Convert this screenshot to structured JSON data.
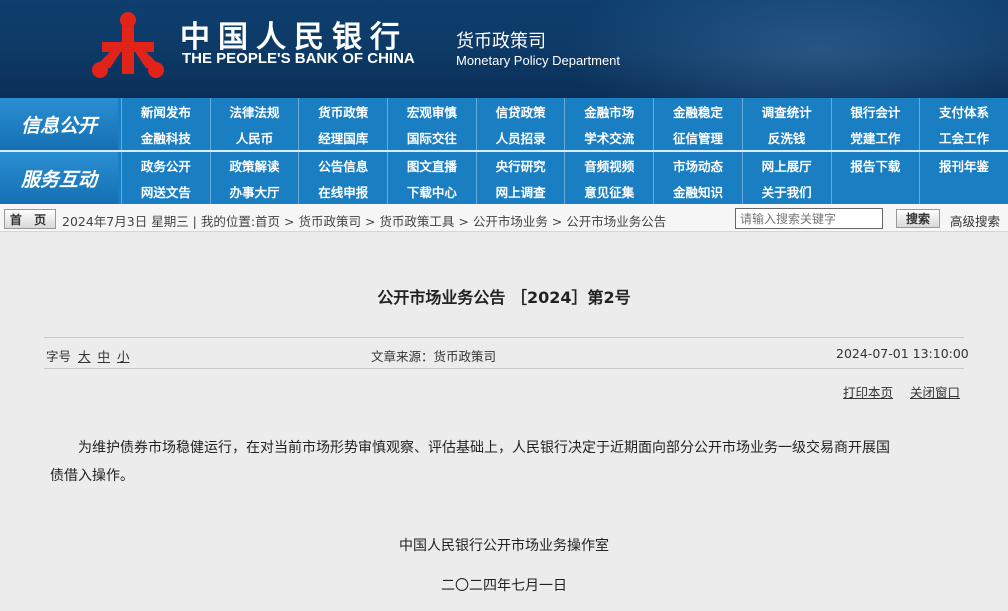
{
  "header": {
    "bank_name_cn": "中国人民银行",
    "bank_name_en": "THE PEOPLE'S BANK OF CHINA",
    "dept_cn": "货币政策司",
    "dept_en": "Monetary Policy Department",
    "logo_icon": "pboc-logo-icon",
    "logo_color": "#e2231a"
  },
  "nav": {
    "groups": [
      {
        "label": "信息公开",
        "items": [
          "新闻发布",
          "法律法规",
          "货币政策",
          "宏观审慎",
          "信贷政策",
          "金融市场",
          "金融稳定",
          "调查统计",
          "银行会计",
          "支付体系",
          "金融科技",
          "人民币",
          "经理国库",
          "国际交往",
          "人员招录",
          "学术交流",
          "征信管理",
          "反洗钱",
          "党建工作",
          "工会工作"
        ]
      },
      {
        "label": "服务互动",
        "items": [
          "政务公开",
          "政策解读",
          "公告信息",
          "图文直播",
          "央行研究",
          "音频视频",
          "市场动态",
          "网上展厅",
          "报告下载",
          "报刊年鉴",
          "网送文告",
          "办事大厅",
          "在线申报",
          "下载中心",
          "网上调查",
          "意见征集",
          "金融知识",
          "关于我们",
          "",
          ""
        ]
      }
    ]
  },
  "breadcrumb": {
    "home_label": "首 页",
    "text": "2024年7月3日 星期三 | 我的位置:首页 > 货币政策司 > 货币政策工具 > 公开市场业务 > 公开市场业务公告",
    "search_placeholder": "请输入搜索关键字",
    "search_button": "搜索",
    "advanced_search": "高级搜索"
  },
  "article": {
    "title": "公开市场业务公告 ［2024］第2号",
    "font_size_label": "字号",
    "font_size_options": [
      "大",
      "中",
      "小"
    ],
    "source": "文章来源：货币政策司",
    "datetime": "2024-07-01 13:10:00",
    "print_label": "打印本页",
    "close_label": "关闭窗口",
    "body_line1": "为维护债券市场稳健运行，在对当前市场形势审慎观察、评估基础上，人民银行决定于近期面向部分公开市场业务一级交易商开展国",
    "body_line2": "债借入操作。",
    "signature": "中国人民银行公开市场业务操作室",
    "date_signed": "二〇二四年七月一日"
  }
}
